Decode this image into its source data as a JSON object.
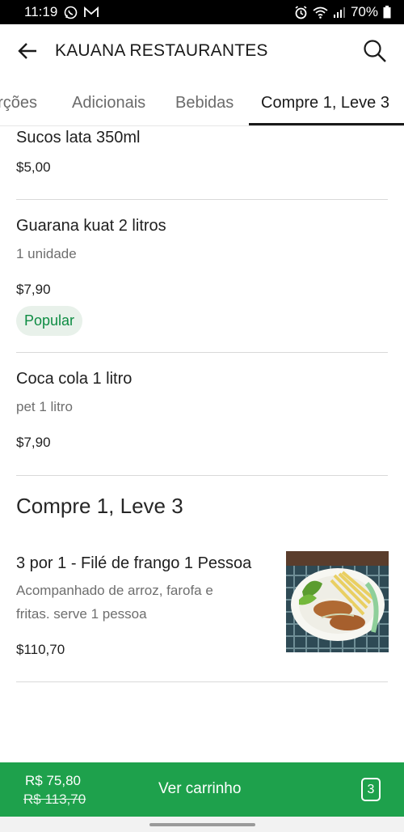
{
  "status_bar": {
    "time": "11:19",
    "battery": "70%",
    "icons": [
      "whatsapp-icon",
      "mail-icon",
      "alarm-icon",
      "wifi-icon",
      "signal-icon",
      "battery-icon"
    ]
  },
  "header": {
    "title": "KAUANA RESTAURANTES"
  },
  "tabs": [
    {
      "label": "orções"
    },
    {
      "label": "Adicionais"
    },
    {
      "label": "Bebidas"
    },
    {
      "label": "Compre 1, Leve 3"
    }
  ],
  "items": [
    {
      "name": "Sucos lata 350ml",
      "price": "$5,00"
    },
    {
      "name": "Guarana kuat 2 litros",
      "description": "1 unidade",
      "price": "$7,90",
      "badge": "Popular"
    },
    {
      "name": "Coca cola 1 litro",
      "description": "pet 1 litro",
      "price": "$7,90"
    }
  ],
  "section": {
    "title": "Compre 1, Leve 3",
    "items": [
      {
        "name": "3 por 1 - Filé de frango 1 Pessoa",
        "description_line1": "Acompanhado de arroz, farofa e",
        "description_line2": "fritas. serve 1 pessoa",
        "price": "$110,70"
      }
    ]
  },
  "cart": {
    "price": "R$ 75,80",
    "old_price": "R$ 113,70",
    "label": "Ver carrinho",
    "count": "3"
  },
  "colors": {
    "accent_green": "#1ea14c",
    "badge_text": "#0e8c43",
    "badge_bg": "#e8f1ea"
  }
}
